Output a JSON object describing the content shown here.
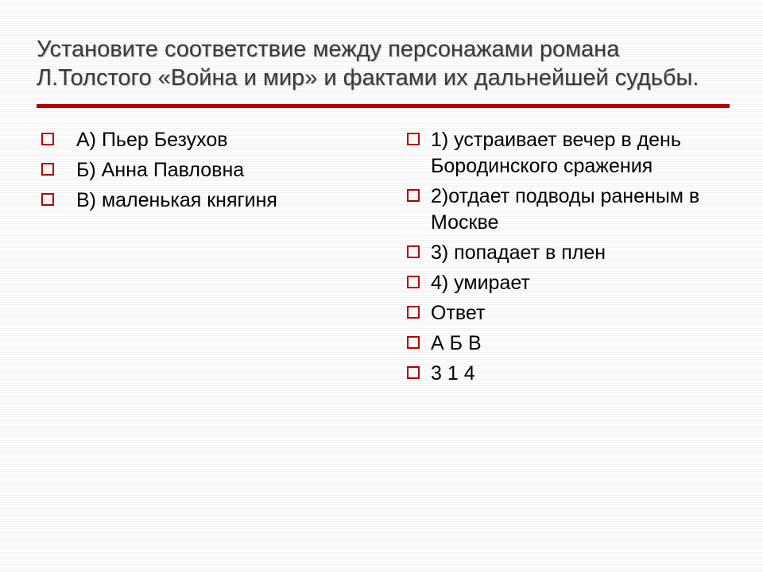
{
  "title": "Установите соответствие между персонажами романа Л.Толстого «Война и мир» и фактами их дальнейшей судьбы.",
  "left": {
    "items": [
      "А) Пьер Безухов",
      "Б) Анна Павловна",
      "В) маленькая княгиня"
    ]
  },
  "right": {
    "items": [
      "1) устраивает вечер в день Бородинского сражения",
      "2)отдает подводы раненым в Москве",
      "3) попадает в плен",
      "4) умирает",
      "Ответ",
      "А   Б   В",
      "3   1   4"
    ]
  }
}
